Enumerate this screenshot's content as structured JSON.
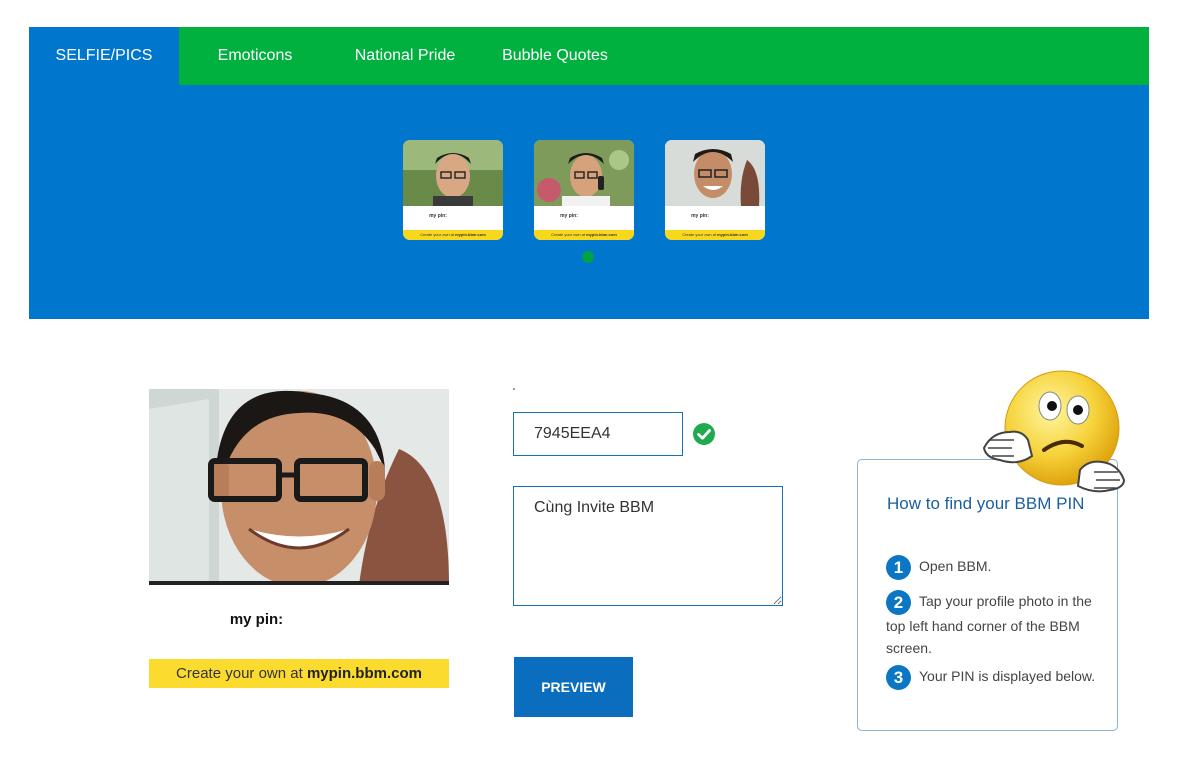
{
  "tabs": [
    {
      "label": "SELFIE/PICS"
    },
    {
      "label": "Emoticons"
    },
    {
      "label": "National Pride"
    },
    {
      "label": "Bubble Quotes"
    }
  ],
  "thumbnail": {
    "pin_label": "my pin:",
    "footer_text": "Create your own at ",
    "footer_link": "mypin.bbm.com"
  },
  "card": {
    "pin_label": "my pin:",
    "footer_text": "Create your own at ",
    "footer_link": "mypin.bbm.com"
  },
  "form": {
    "pin_value": "7945EEA4",
    "message_value": "Cùng Invite BBM",
    "preview_label": "PREVIEW"
  },
  "help": {
    "title": "How to find your BBM PIN",
    "steps": [
      {
        "number": "1",
        "text": "Open BBM."
      },
      {
        "number": "2",
        "text": "Tap your profile photo in the top left hand corner of the BBM screen."
      },
      {
        "number": "3",
        "text": "Your PIN is displayed below."
      }
    ]
  },
  "icons": {
    "pin_valid": "check-circle-icon",
    "help_mascot": "confused-emoji-icon"
  },
  "colors": {
    "banner_blue": "#0077cc",
    "tab_green": "#00b140",
    "strip_yellow": "#fbdc2e",
    "button_blue": "#0a6dbd"
  }
}
